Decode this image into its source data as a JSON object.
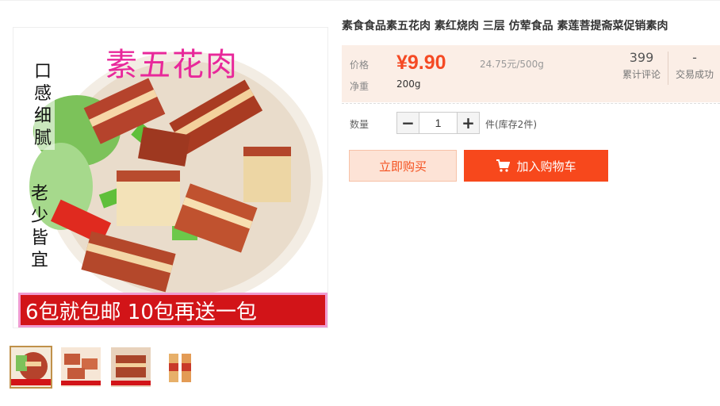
{
  "product": {
    "title": "素食食品素五花肉 素红烧肉 三层 仿荤食品 素莲菩提斋菜促销素肉"
  },
  "main_image": {
    "overlay_title": "素五花肉",
    "vertical_text_left": "口感细腻",
    "vertical_text_bottom": "老少皆宜",
    "banner_text": "6包就包邮 10包再送一包"
  },
  "thumbnails": [
    {
      "name": "main-photo"
    },
    {
      "name": "sliced-photo"
    },
    {
      "name": "pan-photo"
    },
    {
      "name": "package-photo"
    }
  ],
  "price_panel": {
    "price_label": "价格",
    "price": "¥9.90",
    "unit_price": "24.75元/500g",
    "weight_label": "净重",
    "weight": "200g",
    "reviews_count": "399",
    "reviews_label": "累计评论",
    "sales_count": "-",
    "sales_label": "交易成功"
  },
  "quantity": {
    "label": "数量",
    "value": "1",
    "minus": "−",
    "plus": "+",
    "stock_text": "件(库存2件)"
  },
  "actions": {
    "buy_now": "立即购买",
    "add_to_cart": "加入购物车"
  },
  "colors": {
    "accent": "#f7481c",
    "price": "#f54a24",
    "panel_bg": "#fbeee6",
    "buy_bg": "#fde3d6"
  },
  "icons": [
    "cart-icon",
    "minus-icon",
    "plus-icon"
  ]
}
